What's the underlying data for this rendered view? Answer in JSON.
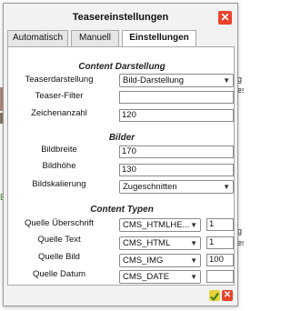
{
  "dialog": {
    "title": "Teasereinstellungen",
    "tabs": [
      {
        "label": "Automatisch",
        "active": false
      },
      {
        "label": "Manuell",
        "active": false
      },
      {
        "label": "Einstellungen",
        "active": true
      }
    ]
  },
  "content_darstellung": {
    "heading": "Content Darstellung",
    "teaserdarstellung": {
      "label": "Teaserdarstellung",
      "value": "Bild-Darstellung"
    },
    "teaser_filter": {
      "label": "Teaser-Filter",
      "value": ""
    },
    "zeichenanzahl": {
      "label": "Zeichenanzahl",
      "value": "120"
    }
  },
  "bilder": {
    "heading": "Bilder",
    "bildbreite": {
      "label": "Bildbreite",
      "value": "170"
    },
    "bildhoehe": {
      "label": "Bildhöhe",
      "value": "130"
    },
    "bildskalierung": {
      "label": "Bildskalierung",
      "value": "Zugeschnitten"
    }
  },
  "content_typen": {
    "heading": "Content Typen",
    "rows": [
      {
        "label": "Quelle Überschrift",
        "select": "CMS_HTMLHE...",
        "number": "1"
      },
      {
        "label": "Quelle Text",
        "select": "CMS_HTML",
        "number": "1"
      },
      {
        "label": "Quelle Bild",
        "select": "CMS_IMG",
        "number": "100"
      },
      {
        "label": "Quelle Datum",
        "select": "CMS_DATE",
        "number": ""
      }
    ]
  },
  "colors": {
    "close": "#e8442c",
    "confirm": "#e6d23a",
    "cancel": "#e8442c"
  },
  "background": {
    "left_letter": "E",
    "right_fragments": [
      "g",
      "es",
      "g",
      "es"
    ]
  }
}
